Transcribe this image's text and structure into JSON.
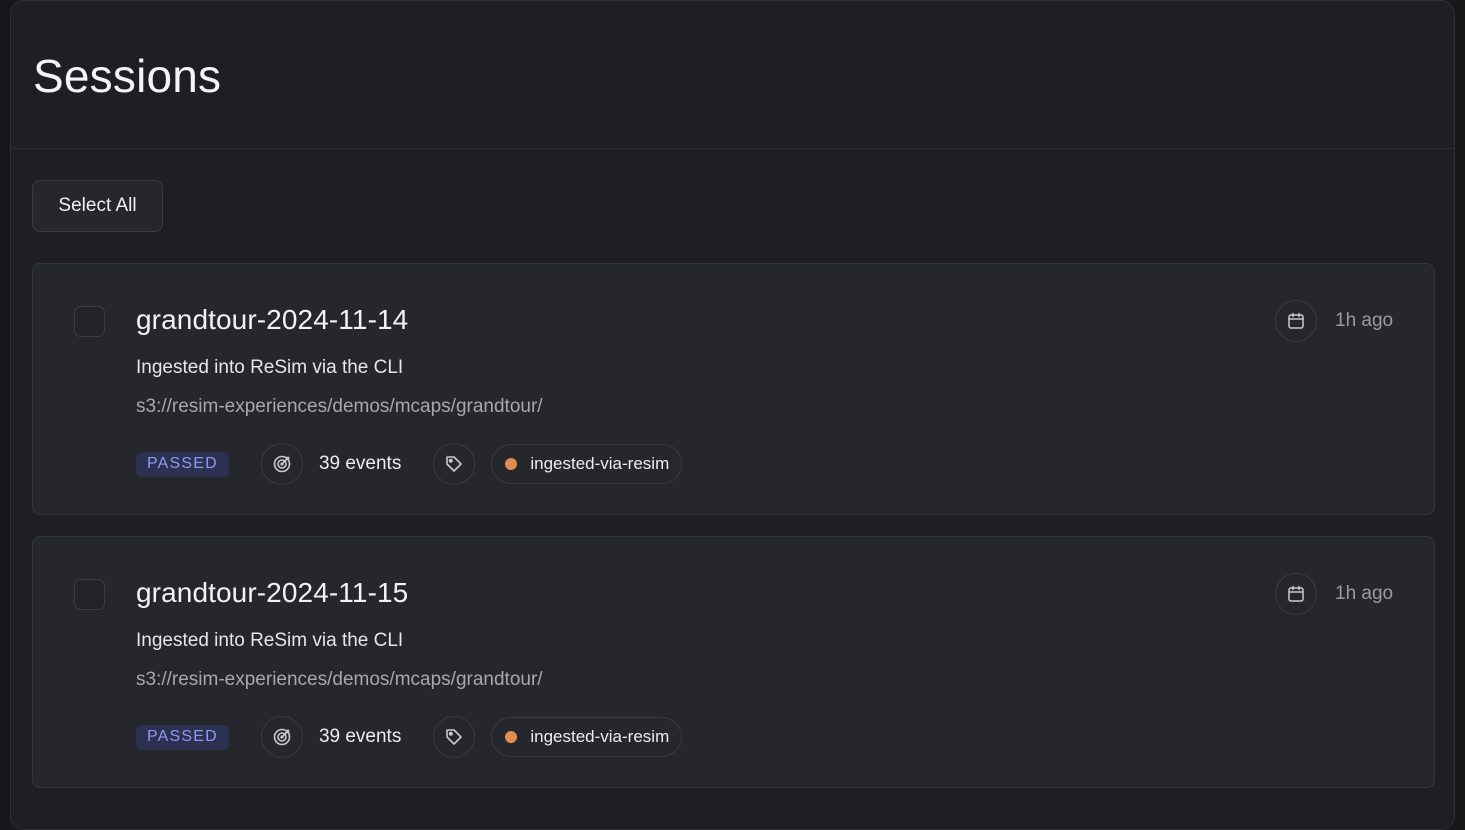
{
  "page": {
    "title": "Sessions"
  },
  "toolbar": {
    "select_all_label": "Select All"
  },
  "sessions": [
    {
      "title": "grandtour-2024-11-14",
      "description": "Ingested into ReSim via the CLI",
      "path": "s3://resim-experiences/demos/mcaps/grandtour/",
      "status": "PASSED",
      "events": "39 events",
      "tag": "ingested-via-resim",
      "time_ago": "1h ago",
      "checked": false
    },
    {
      "title": "grandtour-2024-11-15",
      "description": "Ingested into ReSim via the CLI",
      "path": "s3://resim-experiences/demos/mcaps/grandtour/",
      "status": "PASSED",
      "events": "39 events",
      "tag": "ingested-via-resim",
      "time_ago": "1h ago",
      "checked": false
    }
  ],
  "icons": {
    "events": "target-icon",
    "tag": "tag-icon",
    "date": "calendar-icon"
  },
  "colors": {
    "status_passed_text": "#8d9af2",
    "status_passed_bg": "#2c3152",
    "tag_dot": "#e08d50"
  }
}
